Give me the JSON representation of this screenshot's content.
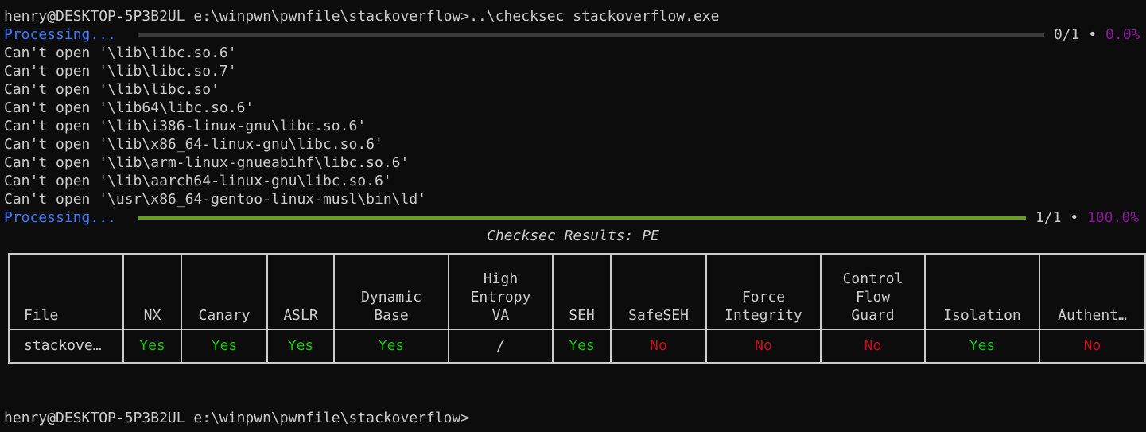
{
  "terminal": {
    "prompt_command": "henry@DESKTOP-5P3B2UL e:\\winpwn\\pwnfile\\stackoverflow>..\\checksec stackoverflow.exe",
    "progress1": {
      "label": "Processing...",
      "count": "0/1",
      "separator": "•",
      "percent_text": "0.0%",
      "fraction": 0.0
    },
    "errors": [
      "Can't open '\\lib\\libc.so.6'",
      "Can't open '\\lib\\libc.so.7'",
      "Can't open '\\lib\\libc.so'",
      "Can't open '\\lib64\\libc.so.6'",
      "Can't open '\\lib\\i386-linux-gnu\\libc.so.6'",
      "Can't open '\\lib\\x86_64-linux-gnu\\libc.so.6'",
      "Can't open '\\lib\\arm-linux-gnueabihf\\libc.so.6'",
      "Can't open '\\lib\\aarch64-linux-gnu\\libc.so.6'",
      "Can't open '\\usr\\x86_64-gentoo-linux-musl\\bin\\ld'"
    ],
    "progress2": {
      "label": "Processing...",
      "count": "1/1",
      "separator": "•",
      "percent_text": "100.0%",
      "fraction": 1.0
    },
    "results_title": "Checksec Results: PE",
    "final_prompt": "henry@DESKTOP-5P3B2UL e:\\winpwn\\pwnfile\\stackoverflow>"
  },
  "colors": {
    "processing": "#3b78ff",
    "bar_empty": "#3a3a3a",
    "bar_full": "#6a9a1f",
    "percent": "#881798",
    "yes": "#16c60c",
    "no": "#c50f1f"
  },
  "table": {
    "headers": [
      "File",
      "NX",
      "Canary",
      "ASLR",
      "Dynamic\nBase",
      "High\nEntropy\nVA",
      "SEH",
      "SafeSEH",
      "Force\nIntegrity",
      "Control\nFlow\nGuard",
      "Isolation",
      "Authent…"
    ],
    "row": [
      {
        "value": "stackove…",
        "status": "neutral"
      },
      {
        "value": "Yes",
        "status": "yes"
      },
      {
        "value": "Yes",
        "status": "yes"
      },
      {
        "value": "Yes",
        "status": "yes"
      },
      {
        "value": "Yes",
        "status": "yes"
      },
      {
        "value": "/",
        "status": "neutral"
      },
      {
        "value": "Yes",
        "status": "yes"
      },
      {
        "value": "No",
        "status": "no"
      },
      {
        "value": "No",
        "status": "no"
      },
      {
        "value": "No",
        "status": "no"
      },
      {
        "value": "Yes",
        "status": "yes"
      },
      {
        "value": "No",
        "status": "no"
      }
    ]
  }
}
